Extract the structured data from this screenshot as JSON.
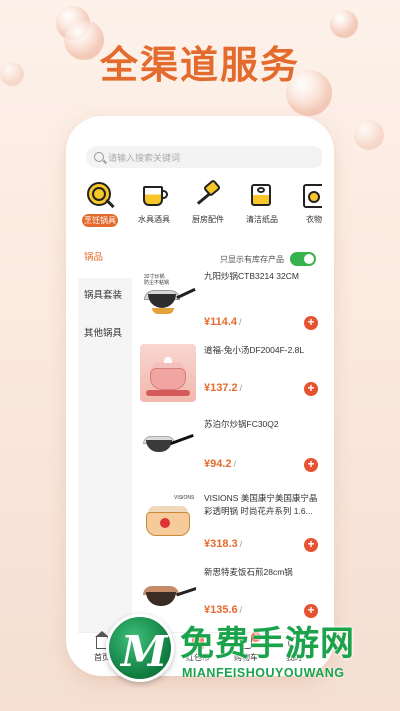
{
  "hero": {
    "title": "全渠道服务"
  },
  "search": {
    "placeholder": "请输入搜索关键词"
  },
  "categories": [
    {
      "label": "烹饪锅具",
      "icon": "pan-icon",
      "active": true
    },
    {
      "label": "水具酒具",
      "icon": "cup-icon"
    },
    {
      "label": "厨房配件",
      "icon": "spatula-icon"
    },
    {
      "label": "清洁纸品",
      "icon": "tissue-roll-icon"
    },
    {
      "label": "衣物",
      "icon": "washer-icon"
    }
  ],
  "sidebar": {
    "items": [
      {
        "label": "锅品",
        "active": true
      },
      {
        "label": "锅具套装"
      },
      {
        "label": "其他锅具"
      }
    ]
  },
  "filter": {
    "stock_only_label": "只显示有库存产品",
    "stock_only_on": true
  },
  "products": [
    {
      "name": "九阳炒锅CTB3214 32CM",
      "price": "¥114.4",
      "unit": "/",
      "thumb_text": "32寸炒锅\n防尘不粘锅"
    },
    {
      "name": "道福-兔小汤DF2004F-2.8L",
      "price": "¥137.2",
      "unit": "/"
    },
    {
      "name": "苏泊尔炒锅FC30Q2",
      "price": "¥94.2",
      "unit": "/"
    },
    {
      "name": "VISIONS 美国康宁美国康宁晶彩透明锅 时尚花卉系列 1.6...",
      "price": "¥318.3",
      "unit": "/",
      "thumb_text": "VISIONS"
    },
    {
      "name": "新思特麦饭石煎28cm锅",
      "price": "¥135.6",
      "unit": "/"
    }
  ],
  "tabbar": {
    "items": [
      {
        "label": "首页"
      },
      {
        "label": "分类"
      },
      {
        "label": "红包币"
      },
      {
        "label": "购物车",
        "badge": "1"
      },
      {
        "label": "我的"
      }
    ]
  },
  "watermark": {
    "title": "免费手游网",
    "subtitle": "MIANFEISHOUYOUWANG",
    "logo_letter": "M"
  },
  "colors": {
    "accent": "#e46b2e",
    "toggle_on": "#37b24d",
    "watermark": "#1aa34a"
  }
}
